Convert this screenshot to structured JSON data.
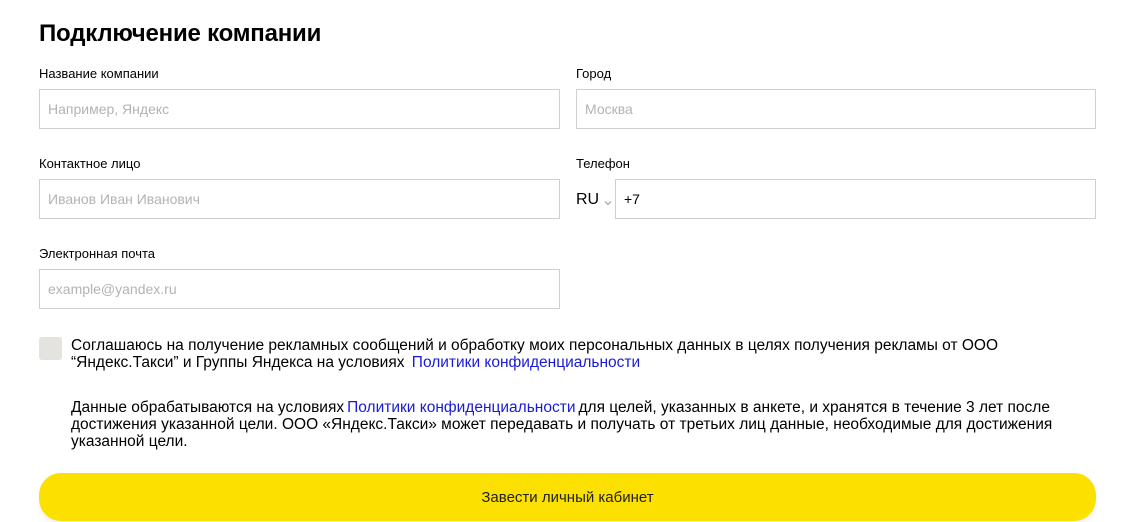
{
  "form": {
    "title": "Подключение компании",
    "company": {
      "label": "Название компании",
      "placeholder": "Например, Яндекс"
    },
    "city": {
      "label": "Город",
      "placeholder": "Москва"
    },
    "contact": {
      "label": "Контактное лицо",
      "placeholder": "Иванов Иван Иванович"
    },
    "phone": {
      "label": "Телефон",
      "country": "RU",
      "value": "+7"
    },
    "email": {
      "label": "Электронная почта",
      "placeholder": "example@yandex.ru"
    },
    "consent": {
      "checked": false,
      "text_before": "Соглашаюсь на получение рекламных сообщений и обработку моих персональных данных в целях получения рекламы от ООО “Яндекс.Такси” и Группы Яндекса на условиях",
      "link": "Политики конфиденциальности"
    },
    "notice": {
      "text_before": "Данные обрабатываются на условиях",
      "link": "Политики конфиденциальности",
      "text_after": "для целей, указанных в анкете, и хранятся в течение 3 лет после достижения указанной цели. ООО «Яндекс.Такси» может передавать и получать от третьих лиц данные, необходимые для достижения указанной цели."
    },
    "submit_label": "Завести личный кабинет"
  },
  "colors": {
    "accent": "#fce000",
    "link": "#1a1ad6",
    "input_border": "#cfcfcf",
    "checkbox_bg": "#e4e3df"
  },
  "icons": {
    "country_dropdown": "chevron-down-icon"
  }
}
